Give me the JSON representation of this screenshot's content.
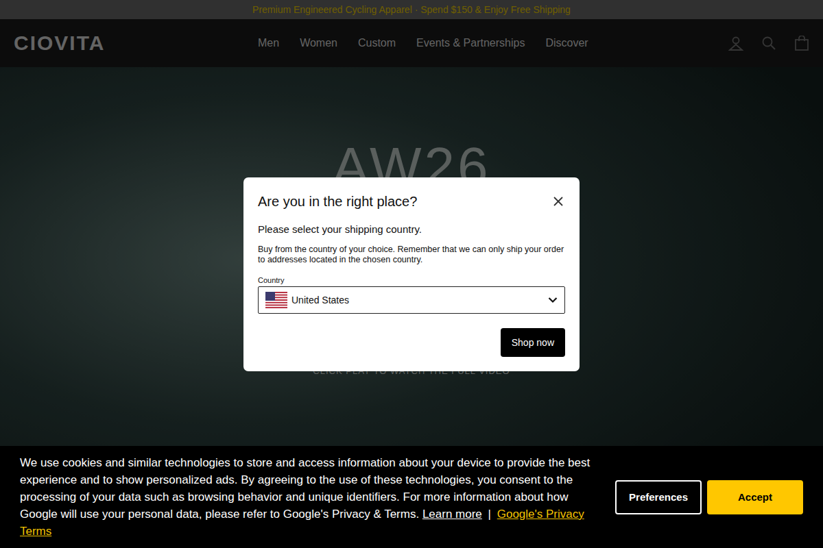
{
  "promo_bar": {
    "text": "Premium Engineered Cycling Apparel · Spend $150 & Enjoy Free Shipping"
  },
  "header": {
    "logo": "CIOVITA",
    "nav": [
      "Men",
      "Women",
      "Custom",
      "Events & Partnerships",
      "Discover"
    ]
  },
  "hero": {
    "title": "AW26",
    "caption": "CLICK PLAY TO WATCH THE FULL VIDEO"
  },
  "modal": {
    "title": "Are you in the right place?",
    "subtitle": "Please select your shipping country.",
    "body": "Buy from the country of your choice. Remember that we can only ship your order to addresses located in the chosen country.",
    "country_label": "Country",
    "country": "United States",
    "button": "Shop now"
  },
  "cookie_banner": {
    "text": "We use cookies and similar technologies to store and access information about your device to provide the best experience and to show personalized ads. By agreeing to the use of these technologies, you consent to the processing of your data such as browsing behavior and unique identifiers. For more information about how Google will use your personal data, please refer to Google's Privacy & Terms.",
    "links": [
      "Learn more",
      "Google's Privacy Terms"
    ],
    "separator": "|",
    "buttons": [
      "Preferences",
      "Accept"
    ]
  }
}
